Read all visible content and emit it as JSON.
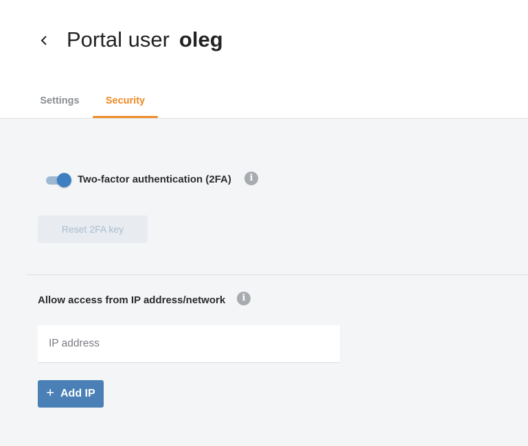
{
  "header": {
    "title": "Portal user",
    "username": "oleg"
  },
  "tabs": [
    {
      "label": "Settings",
      "active": false
    },
    {
      "label": "Security",
      "active": true
    }
  ],
  "security": {
    "twofa": {
      "label": "Two-factor authentication (2FA)",
      "enabled": true,
      "info_icon": "info-icon"
    },
    "reset_button": {
      "label": "Reset 2FA key",
      "disabled": true
    },
    "ip_access": {
      "label": "Allow access from IP address/network",
      "input_placeholder": "IP address",
      "input_value": "",
      "add_button_label": "Add IP",
      "add_button_icon": "plus-icon"
    }
  },
  "colors": {
    "accent": "#ee8a24",
    "primary": "#4a80b6",
    "toggle_on": "#3d7fc1",
    "background": "#f4f5f7"
  }
}
